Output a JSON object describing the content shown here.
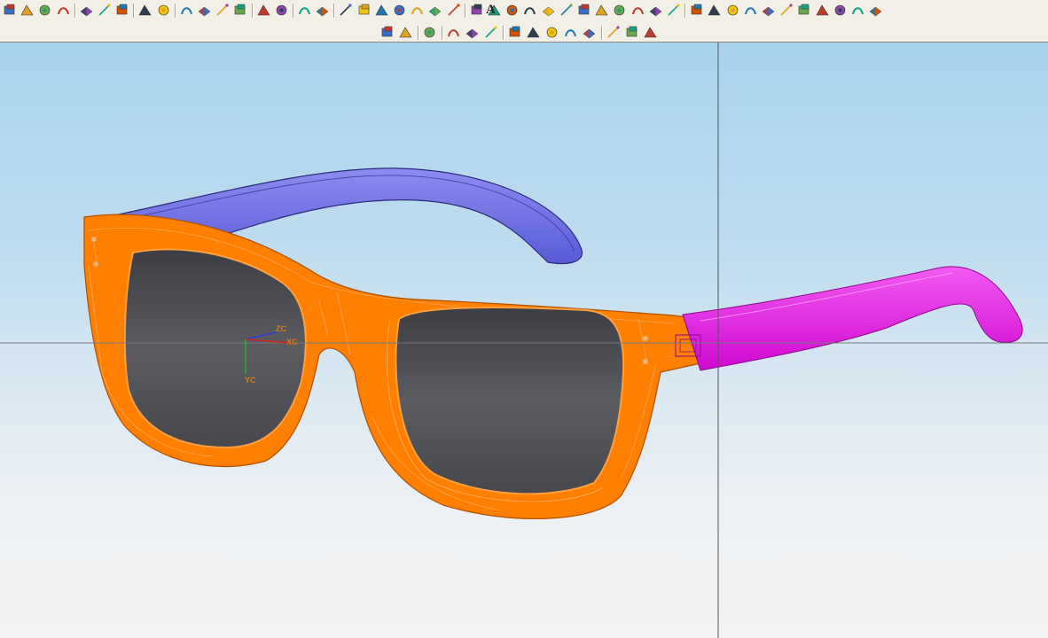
{
  "toolbar": {
    "row1_icons": [
      "open-part-icon",
      "edit-sketch-icon",
      "datum-plane-icon",
      "layer-icon",
      "extrude-icon",
      "revolve-icon",
      "sweep-icon",
      "blend-icon",
      "chamfer-icon",
      "shell-icon",
      "draft-icon",
      "trim-body-icon",
      "sew-icon",
      "rectangle-select-icon",
      "erase-icon",
      "orient-icon",
      "rotate-view-icon",
      "line-icon",
      "arc-icon",
      "spline-icon",
      "point-icon",
      "text-icon",
      "cross-point-icon",
      "rectangle-icon",
      "circle-icon",
      "sphere-icon",
      "cylinder-icon",
      "curve-offset-icon",
      "curve-project-icon",
      "curve-intersect-icon",
      "extract-curve-icon",
      "surface-icon",
      "bridge-icon",
      "law-curve-icon",
      "helix-icon",
      "combine-icon",
      "shade-icon",
      "wireframe-icon",
      "hidden-line-icon",
      "section-icon",
      "bar-chart-icon",
      "cube-icon",
      "building-icon",
      "tube-icon",
      "block-icon",
      "green-body-icon",
      "green-gear-icon"
    ],
    "row1_text_icon": "A",
    "row2_icons": [
      "measure-distance-icon",
      "measure-angle-icon",
      "snap-point-icon",
      "shaded-body-icon",
      "shaded-edges-icon",
      "render-style-icon",
      "analysis-icon",
      "curvature-icon",
      "plus-point-icon",
      "deviation-icon",
      "draft-analysis-icon",
      "line-tool-icon",
      "slash-tool-icon",
      "hook-tool-icon"
    ]
  },
  "viewport": {
    "background_top": "#a9d3eb",
    "background_bottom": "#f3f3f3",
    "colors": {
      "frame": "#ff7f00",
      "frame_edge": "#ffb066",
      "lens": "#4a4c52",
      "temple_left": "#6e6ee6",
      "temple_right": "#e817e8"
    },
    "wcs": {
      "zc": "ZC",
      "xc": "XC",
      "yc": "YC"
    }
  }
}
